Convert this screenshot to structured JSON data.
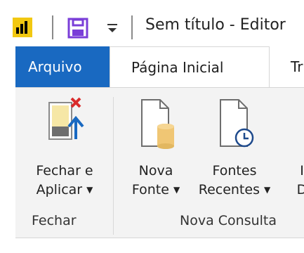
{
  "titlebar": {
    "title": "Sem título - Editor",
    "icons": [
      "power-bi-logo",
      "save-icon",
      "customize-quick-access-icon"
    ]
  },
  "tabs": [
    {
      "label": "Arquivo"
    },
    {
      "label": "Página Inicial"
    },
    {
      "label": "Tr"
    }
  ],
  "ribbon": {
    "buttons": [
      {
        "line1": "Fechar e",
        "line2": "Aplicar"
      },
      {
        "line1": "Nova",
        "line2": "Fonte"
      },
      {
        "line1": "Fontes",
        "line2": "Recentes"
      },
      {
        "line1": "I",
        "line2": "D"
      }
    ],
    "groups": [
      {
        "label": "Fechar"
      },
      {
        "label": "Nova Consulta"
      }
    ]
  },
  "colors": {
    "file_tab": "#1969c1",
    "save_icon": "#7a3ed8",
    "logo_yellow": "#f2c811",
    "close_x": "#d92b2b",
    "arrow_blue": "#1969c1",
    "ribbon_bg": "#f3f3f3"
  }
}
